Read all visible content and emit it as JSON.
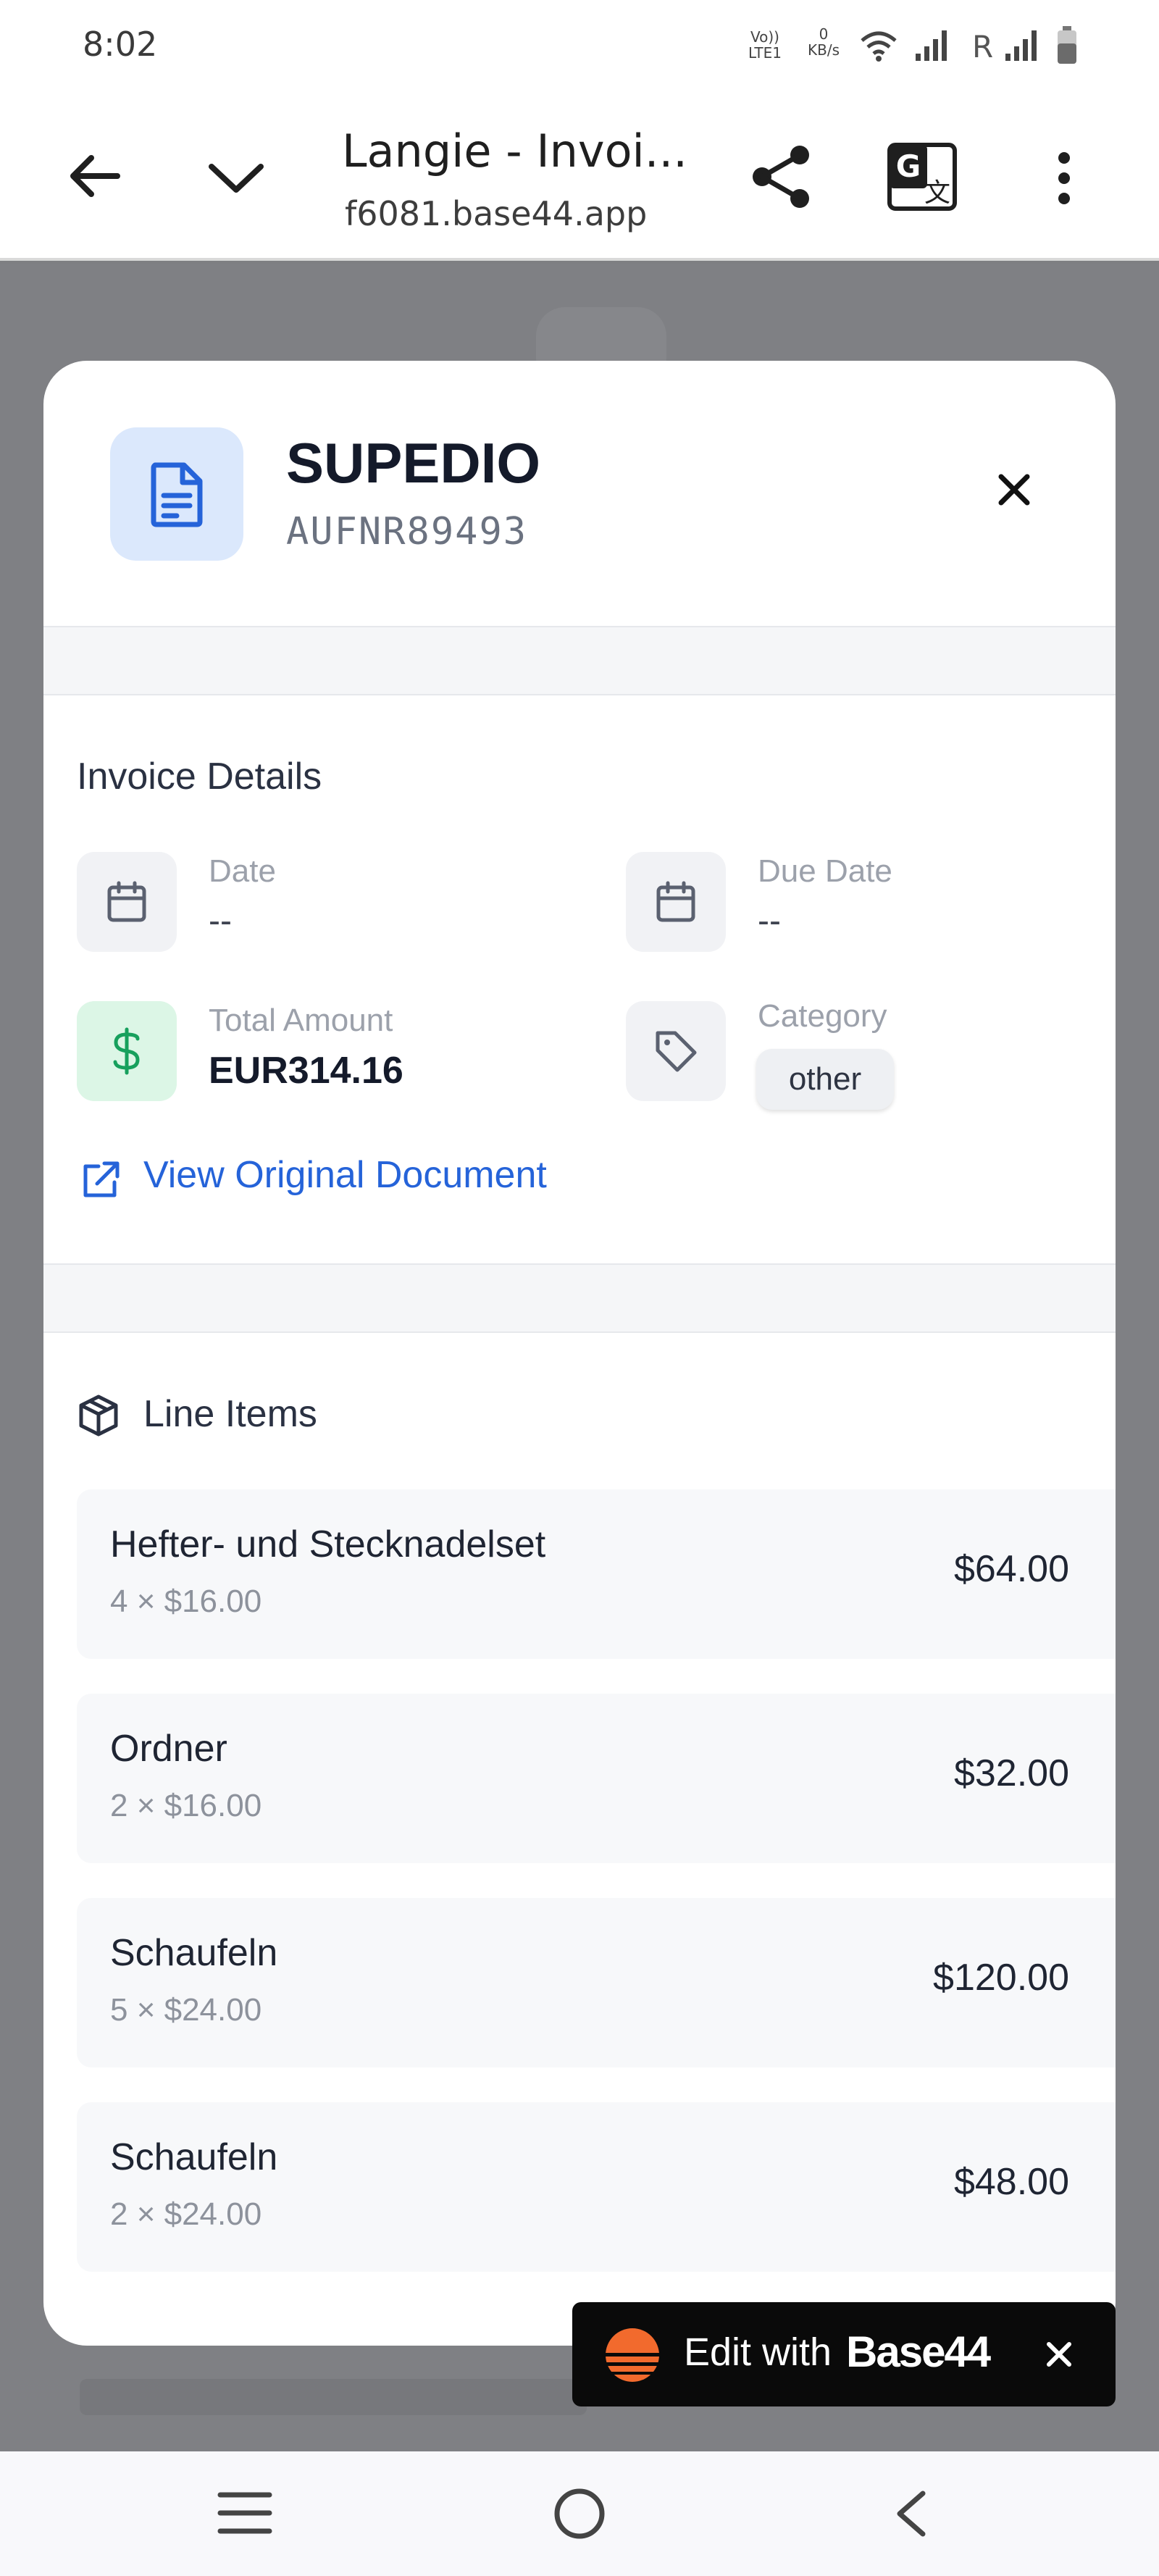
{
  "status_bar": {
    "time": "8:02",
    "volte_label": "Vo)) LTE1",
    "speed_value": "0",
    "speed_unit": "KB/s",
    "roaming": "R"
  },
  "browser": {
    "title": "Langie - Invoi...",
    "url": "f6081.base44.app"
  },
  "modal": {
    "vendor": "SUPEDIO",
    "invoice_number": "AUFNR89493",
    "details_title": "Invoice Details",
    "date_label": "Date",
    "date_value": "--",
    "due_label": "Due Date",
    "due_value": "--",
    "total_label": "Total Amount",
    "total_value": "EUR314.16",
    "category_label": "Category",
    "category_value": "other",
    "view_link": "View Original Document",
    "line_items_title": "Line Items",
    "line_items": [
      {
        "name": "Hefter- und Stecknadelset",
        "detail": "4 × $16.00",
        "total": "$64.00"
      },
      {
        "name": "Ordner",
        "detail": "2 × $16.00",
        "total": "$32.00"
      },
      {
        "name": "Schaufeln",
        "detail": "5 × $24.00",
        "total": "$120.00"
      },
      {
        "name": "Schaufeln",
        "detail": "2 × $24.00",
        "total": "$48.00"
      }
    ]
  },
  "edit_banner": {
    "prefix": "Edit with",
    "brand": "Base44"
  },
  "colors": {
    "accent_blue": "#2563d9",
    "money_green": "#17a05d",
    "icon_blue_bg": "#dbe8fc",
    "banner_orange": "#f26a2d"
  },
  "icons": [
    "back-arrow-icon",
    "chevron-down-icon",
    "share-icon",
    "translate-icon",
    "more-vert-icon",
    "document-icon",
    "close-icon",
    "calendar-icon",
    "dollar-icon",
    "tag-icon",
    "external-link-icon",
    "package-icon",
    "base44-logo-icon",
    "menu-icon",
    "home-circle-icon",
    "back-chevron-icon"
  ]
}
